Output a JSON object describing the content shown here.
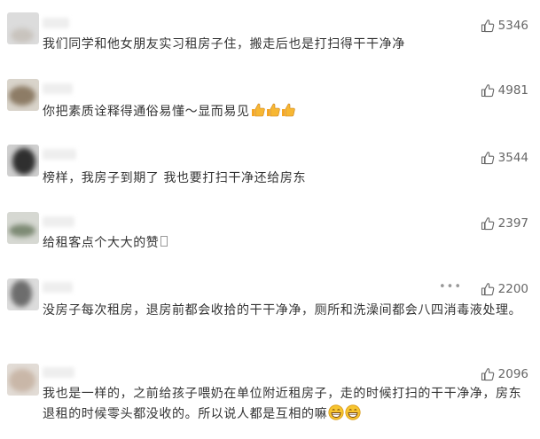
{
  "comments": [
    {
      "text": "我们同学和他女朋友实习租房子住，搬走后也是打扫得干干净净",
      "likes": "5346"
    },
    {
      "text": "你把素质诠释得通俗易懂～显而易见",
      "likes": "4981"
    },
    {
      "text": "榜样，我房子到期了 我也要打扫干净还给房东",
      "likes": "3544"
    },
    {
      "text": "给租客点个大大的赞",
      "likes": "2397"
    },
    {
      "text": "没房子每次租房，退房前都会收拾的干干净净，厕所和洗澡间都会八四消毒液处理。",
      "likes": "2200"
    },
    {
      "text": "我也是一样的，之前给孩子喂奶在单位附近租房子，走的时候打扫的干干净净，房东退租的时候零头都没收的。所以说人都是互相的嘛",
      "likes": "2096"
    }
  ],
  "icons": {
    "like": "thumb-up-outline-icon",
    "more": "more-dots-icon",
    "emoji_thumb": "thumbs-up-emoji",
    "emoji_grin": "grinning-emoji"
  },
  "colors": {
    "text": "#333333",
    "likes": "#666666",
    "emoji": "#f5a623"
  }
}
